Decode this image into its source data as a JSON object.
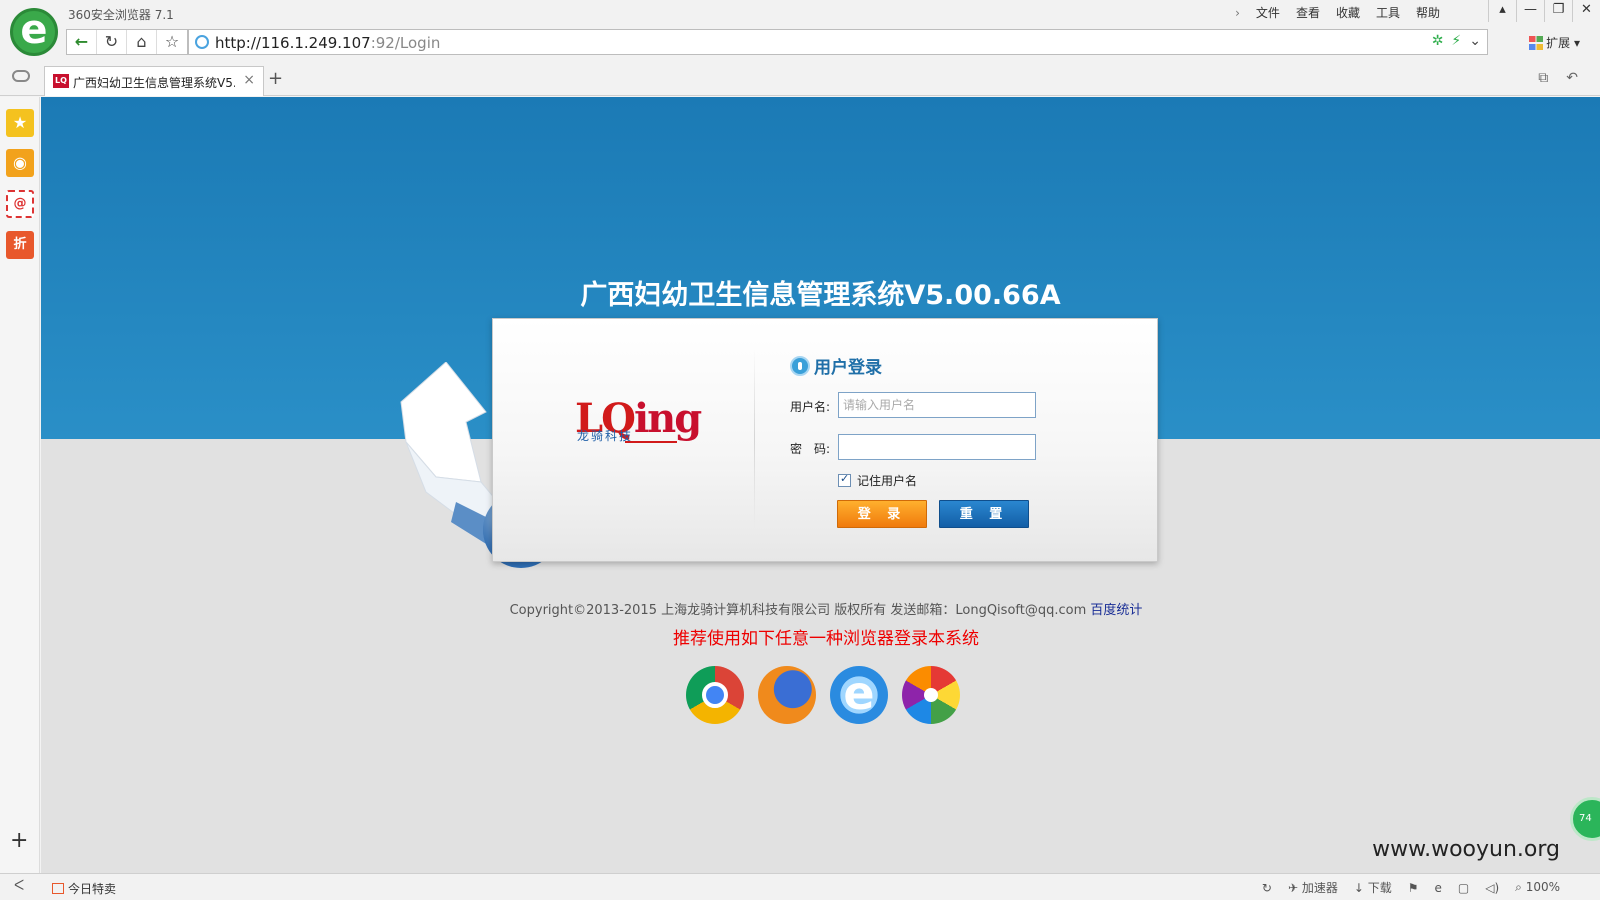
{
  "browser": {
    "app_title": "360安全浏览器 7.1",
    "menu": [
      "文件",
      "查看",
      "收藏",
      "工具",
      "帮助"
    ],
    "url_host": "http://116.1.249.107",
    "url_rest": ":92/Login",
    "extensions_label": "扩展",
    "tab_title": "广西妇幼卫生信息管理系统V5.(",
    "tab_favicon": "LQ"
  },
  "page": {
    "system_title": "广西妇幼卫生信息管理系统V5.00.66A",
    "logo_text_l": "LQ",
    "logo_text_r": "ing",
    "logo_sub": "龙骑科技",
    "login_heading": "用户登录",
    "username_label": "用户名:",
    "username_placeholder": "请输入用户名",
    "username_value": "",
    "password_label": "密　码:",
    "password_value": "",
    "remember_label": "记住用户名",
    "remember_checked": true,
    "login_button": "登 录",
    "reset_button": "重 置",
    "copyright": "Copyright©2013-2015 上海龙骑计算机科技有限公司 版权所有 发送邮箱：LongQisoft@qq.com ",
    "stats_link": "百度统计",
    "recommend": "推荐使用如下任意一种浏览器登录本系统",
    "browsers": [
      "chrome-icon",
      "firefox-icon",
      "ie-icon",
      "360-icon"
    ],
    "float_ball": "74"
  },
  "statusbar": {
    "today_deals": "今日特卖",
    "accelerator": "加速器",
    "download": "下载",
    "zoom": "100%"
  },
  "watermark": "www.wooyun.org",
  "colors": {
    "banner": "#1b7ab5",
    "login_button": "#f07a0c",
    "reset_button": "#135ea6",
    "recommend_text": "#ee0000"
  }
}
